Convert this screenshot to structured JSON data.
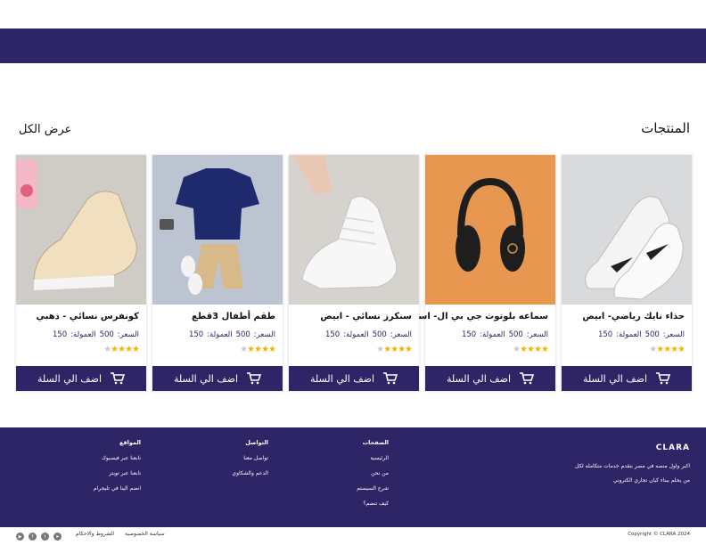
{
  "header": {
    "bar_color": "#2e2567"
  },
  "section": {
    "title": "المنتجات",
    "view_all": "عرض الكل"
  },
  "products": [
    {
      "name": "حذاء نايك رياضي- ابيض",
      "price_label": "السعر:",
      "price": "500",
      "commission_label": "العمولة:",
      "commission": "150",
      "rating": 4,
      "button": "اضف الي السلة"
    },
    {
      "name": "سماعه بلوتوث جي بي ال- اسود",
      "price_label": "السعر:",
      "price": "500",
      "commission_label": "العمولة:",
      "commission": "150",
      "rating": 4,
      "button": "اضف الي السلة"
    },
    {
      "name": "سنكرز نسائي - ابيض",
      "price_label": "السعر:",
      "price": "500",
      "commission_label": "العمولة:",
      "commission": "150",
      "rating": 4,
      "button": "اضف الي السلة"
    },
    {
      "name": "طقم أطفال 3قطع",
      "price_label": "السعر:",
      "price": "500",
      "commission_label": "العمولة:",
      "commission": "150",
      "rating": 4,
      "button": "اضف الي السلة"
    },
    {
      "name": "كونفرس نسائي - ذهبي",
      "price_label": "السعر:",
      "price": "500",
      "commission_label": "العمولة:",
      "commission": "150",
      "rating": 4,
      "button": "اضف الي السلة"
    }
  ],
  "footer": {
    "logo": "CLARA",
    "tagline_1": "اكبر واول منصه في مصر بتقدم خدمات متكامله لكل",
    "tagline_2": "من يحلم ببناء كيان تجاري الكتروني",
    "col_pages": {
      "title": "الصفحات",
      "links": [
        "الرئيسية",
        "من نحن",
        "شرح السيستم",
        "كيف تنضم؟"
      ]
    },
    "col_contact": {
      "title": "التواصل",
      "links": [
        "تواصل معنا",
        "الدعم والشكاوي"
      ]
    },
    "col_sites": {
      "title": "المواقع",
      "links": [
        "تابعنا عبر فيسبوك",
        "تابعنا عبر تويتر",
        "انضم الينا في تليجرام"
      ]
    },
    "copyright": "Copyright © CLARA 2024",
    "privacy": "سياسة الخصوصية",
    "terms": "الشروط والاحكام"
  },
  "colors": {
    "primary": "#2e2567",
    "star": "#f5b301"
  }
}
